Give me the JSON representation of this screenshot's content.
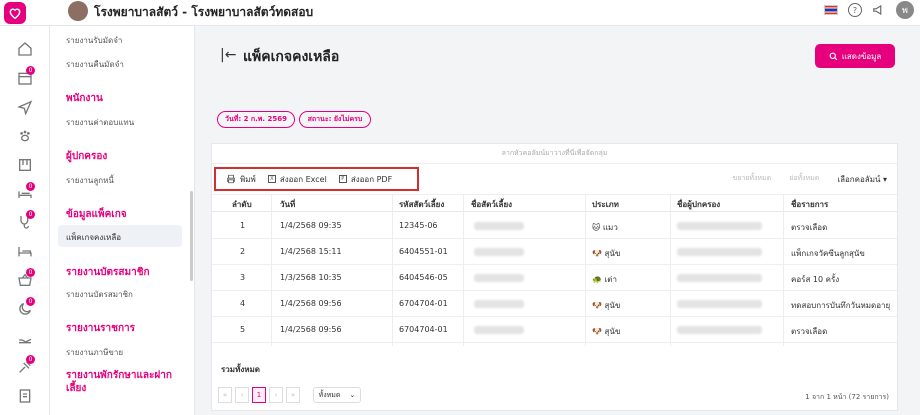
{
  "header": {
    "clinic_title": "โรงพยาบาลสัตว์ - โรงพยาบาลสัตว์ทดสอบ",
    "user_initial": "พ"
  },
  "rail_badges": [
    "0",
    "0",
    "0",
    "0",
    "0",
    "0"
  ],
  "menu": {
    "items": [
      {
        "label": "รายงานรับมัดจำ",
        "type": "item"
      },
      {
        "label": "รายงานคืนมัดจำ",
        "type": "item"
      },
      {
        "label": "พนักงาน",
        "type": "head"
      },
      {
        "label": "รายงานค่าตอบแทน",
        "type": "item"
      },
      {
        "label": "ผู้ปกครอง",
        "type": "head"
      },
      {
        "label": "รายงานลูกหนี้",
        "type": "item"
      },
      {
        "label": "ข้อมูลแพ็คเกจ",
        "type": "head"
      },
      {
        "label": "แพ็คเกจคงเหลือ",
        "type": "active"
      },
      {
        "label": "รายงานบัตรสมาชิก",
        "type": "head"
      },
      {
        "label": "รายงานบัตรสมาชิก",
        "type": "item"
      },
      {
        "label": "รายงานราชการ",
        "type": "head"
      },
      {
        "label": "รายงานภาษีขาย",
        "type": "item"
      },
      {
        "label": "รายงานพักรักษาและฝากเลี้ยง",
        "type": "head2"
      }
    ]
  },
  "page": {
    "title": "แพ็คเกจคงเหลือ",
    "show_button": "แสดงข้อมูล",
    "chip_date": "วันที่: 2 ก.พ. 2569",
    "chip_status": "สถานะ: ยังไม่ครบ"
  },
  "grid": {
    "group_hint": "ลากหัวคอลัมน์มาวางที่นี่เพื่อจัดกลุ่ม",
    "print": "พิมพ์",
    "export_excel": "ส่งออก Excel",
    "export_pdf": "ส่งออก PDF",
    "expand_all": "ขยายทั้งหมด",
    "collapse_all": "ย่อทั้งหมด",
    "choose_columns": "เลือกคอลัมน์",
    "columns": [
      "ลำดับ",
      "วันที่",
      "รหัสสัตว์เลี้ยง",
      "ชื่อสัตว์เลี้ยง",
      "ประเภท",
      "ชื่อผู้ปกครอง",
      "ชื่อรายการ"
    ],
    "rows": [
      {
        "no": "1",
        "date": "1/4/2568 09:35",
        "code": "12345-06",
        "type": "แมว",
        "type_icon": "🐱",
        "item": "ตรวจเลือด"
      },
      {
        "no": "2",
        "date": "1/4/2568 15:11",
        "code": "6404551-01",
        "type": "สุนัข",
        "type_icon": "🐶",
        "item": "แพ็กเกจวัคซีนลูกสุนัข"
      },
      {
        "no": "3",
        "date": "1/3/2568 10:35",
        "code": "6404546-05",
        "type": "เต่า",
        "type_icon": "🐢",
        "item": "คอร์ส 10 ครั้ง"
      },
      {
        "no": "4",
        "date": "1/4/2568 09:56",
        "code": "6704704-01",
        "type": "สุนัข",
        "type_icon": "🐶",
        "item": "ทดสอบการบันทึกวันหมดอายุ"
      },
      {
        "no": "5",
        "date": "1/4/2568 09:56",
        "code": "6704704-01",
        "type": "สุนัข",
        "type_icon": "🐶",
        "item": "ตรวจเลือด"
      }
    ],
    "summary_label": "รวมทั้งหมด",
    "pager": {
      "first": "«",
      "prev": "‹",
      "page": "1",
      "next": "›",
      "last": "»",
      "size": "ทั้งหมด",
      "info": "1 จาก 1 หน้า (72 รายการ)"
    }
  },
  "colors": {
    "accent": "#e6007e",
    "highlight_box": "#d32f2f"
  }
}
